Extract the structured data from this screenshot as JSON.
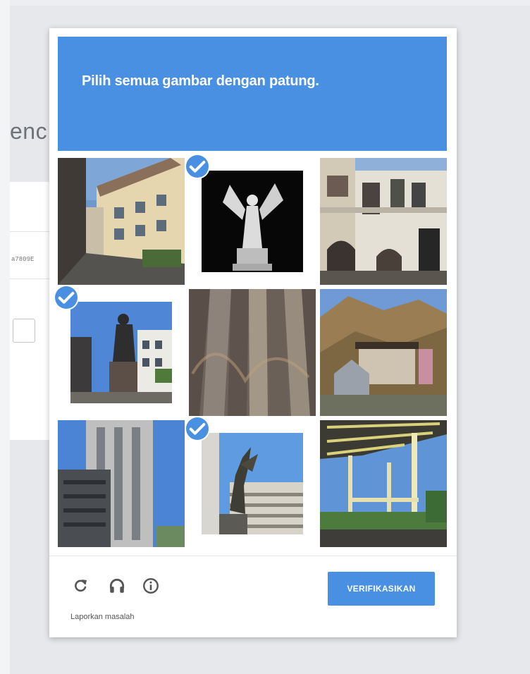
{
  "background": {
    "heading_fragment": "enc",
    "field_value": "a7809E"
  },
  "captcha": {
    "prompt_prefix": "Pilih semua gambar dengan ",
    "prompt_keyword": "patung.",
    "accent_color": "#4a90e2",
    "tiles": [
      {
        "index": 1,
        "subject": "street with houses",
        "selected": false
      },
      {
        "index": 2,
        "subject": "winged statue",
        "selected": true
      },
      {
        "index": 3,
        "subject": "old building facade",
        "selected": false
      },
      {
        "index": 4,
        "subject": "statue in town square",
        "selected": true
      },
      {
        "index": 5,
        "subject": "stone columns",
        "selected": false
      },
      {
        "index": 6,
        "subject": "house by mountains",
        "selected": false
      },
      {
        "index": 7,
        "subject": "apartment tower",
        "selected": false
      },
      {
        "index": 8,
        "subject": "sculpture on building",
        "selected": true
      },
      {
        "index": 9,
        "subject": "pergola structure",
        "selected": false
      }
    ],
    "footer": {
      "reload_icon": "reload-icon",
      "audio_icon": "headphones-icon",
      "info_icon": "info-icon",
      "report_link": "Laporkan masalah",
      "verify_button": "VERIFIKASIKAN"
    }
  }
}
